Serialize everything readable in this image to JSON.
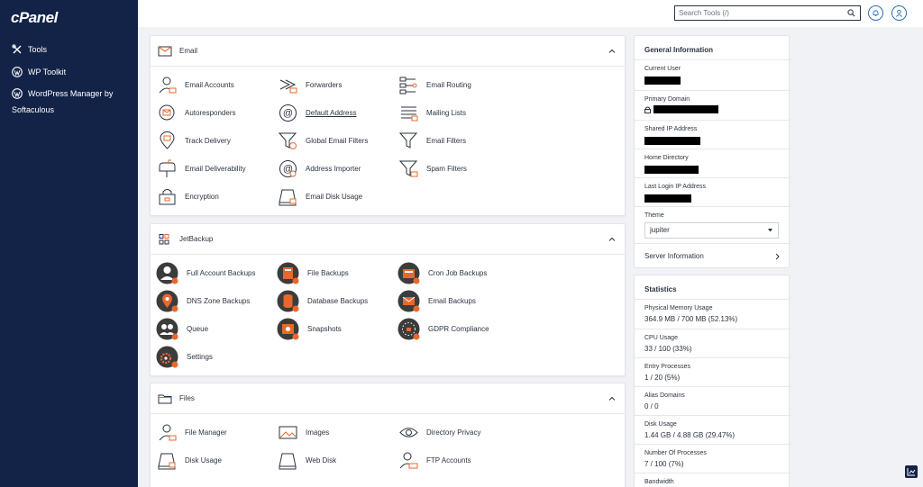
{
  "sidebar": {
    "logo": "cPanel",
    "items": [
      {
        "label": "Tools",
        "icon": "tools-icon"
      },
      {
        "label": "WP Toolkit",
        "icon": "wordpress-icon"
      },
      {
        "label": "WordPress Manager by",
        "label2": "Softaculous",
        "icon": "wordpress-icon"
      }
    ]
  },
  "header": {
    "search_placeholder": "Search Tools (/)"
  },
  "email": {
    "title": "Email",
    "items": [
      {
        "label": "Email Accounts"
      },
      {
        "label": "Forwarders"
      },
      {
        "label": "Email Routing"
      },
      {
        "label": "Autoresponders"
      },
      {
        "label": "Default Address"
      },
      {
        "label": "Mailing Lists"
      },
      {
        "label": "Track Delivery"
      },
      {
        "label": "Global Email Filters"
      },
      {
        "label": "Email Filters"
      },
      {
        "label": "Email Deliverability"
      },
      {
        "label": "Address Importer"
      },
      {
        "label": "Spam Filters"
      },
      {
        "label": "Encryption"
      },
      {
        "label": "Email Disk Usage"
      }
    ]
  },
  "jetbackup": {
    "title": "JetBackup",
    "items": [
      {
        "label": "Full Account Backups"
      },
      {
        "label": "File Backups"
      },
      {
        "label": "Cron Job Backups"
      },
      {
        "label": "DNS Zone Backups"
      },
      {
        "label": "Database Backups"
      },
      {
        "label": "Email Backups"
      },
      {
        "label": "Queue"
      },
      {
        "label": "Snapshots"
      },
      {
        "label": "GDPR Compliance"
      },
      {
        "label": "Settings"
      }
    ]
  },
  "files": {
    "title": "Files",
    "items": [
      {
        "label": "File Manager"
      },
      {
        "label": "Images"
      },
      {
        "label": "Directory Privacy"
      },
      {
        "label": "Disk Usage"
      },
      {
        "label": "Web Disk"
      },
      {
        "label": "FTP Accounts"
      }
    ]
  },
  "general": {
    "title": "General Information",
    "current_user": "Current User",
    "primary_domain": "Primary Domain",
    "shared_ip": "Shared IP Address",
    "home_dir": "Home Directory",
    "last_login": "Last Login IP Address",
    "theme_label": "Theme",
    "theme_value": "jupiter",
    "server_info": "Server Information"
  },
  "stats": {
    "title": "Statistics",
    "rows": [
      {
        "label": "Physical Memory Usage",
        "value": "364.9 MB / 700 MB   (52.13%)"
      },
      {
        "label": "CPU Usage",
        "value": "33 / 100   (33%)"
      },
      {
        "label": "Entry Processes",
        "value": "1 / 20   (5%)"
      },
      {
        "label": "Alias Domains",
        "value": "0 / 0"
      },
      {
        "label": "Disk Usage",
        "value": "1.44 GB / 4.88 GB   (29.47%)"
      },
      {
        "label": "Number Of Processes",
        "value": "7 / 100   (7%)"
      },
      {
        "label": "Bandwidth",
        "value": ""
      }
    ]
  },
  "colors": {
    "sidebar": "#132348",
    "accent": "#e8682c",
    "link": "#2a6fb2"
  }
}
